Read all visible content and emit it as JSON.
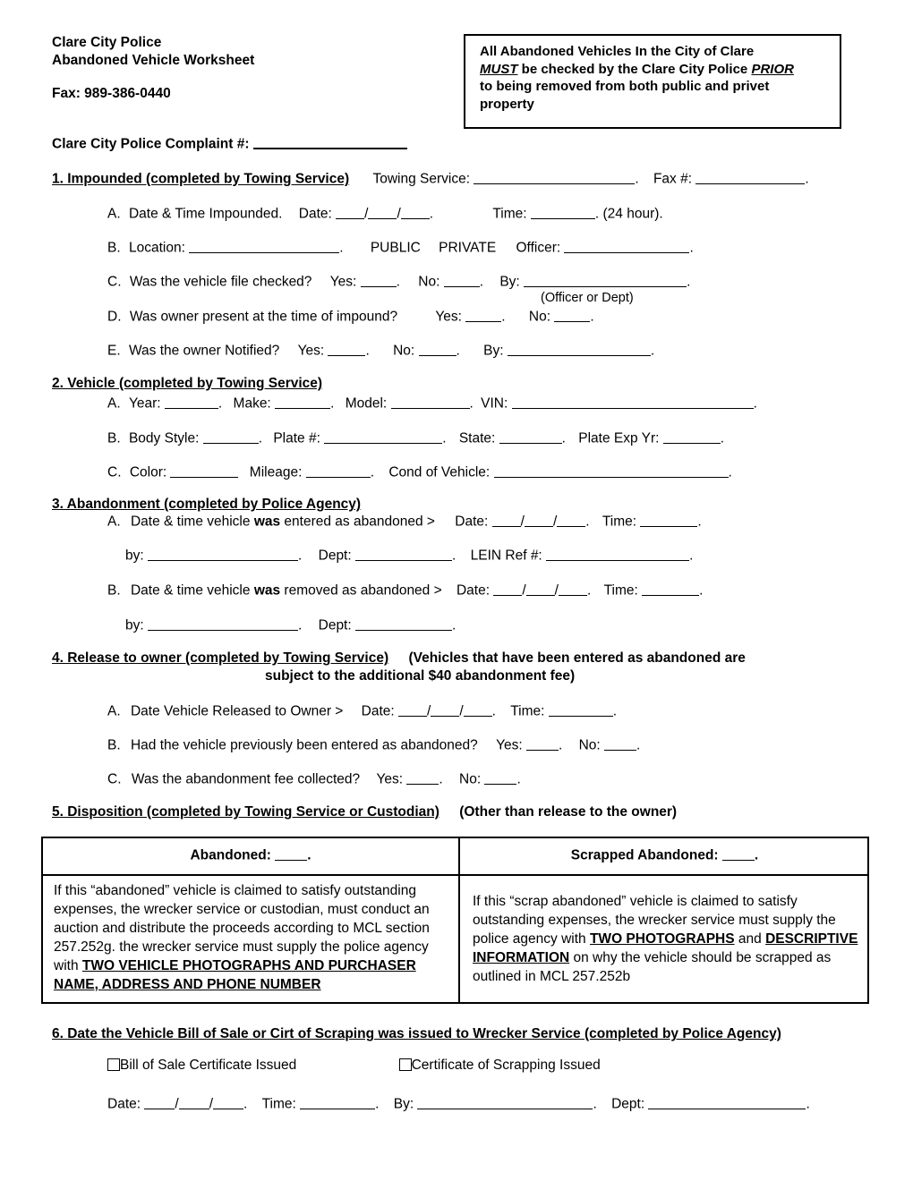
{
  "header": {
    "org_line1": "Clare City Police",
    "org_line2": "Abandoned Vehicle Worksheet",
    "fax": "Fax: 989-386-0440",
    "complaint_label": "Clare City Police Complaint #:"
  },
  "notice": {
    "line1": "All Abandoned Vehicles In the City of Clare",
    "must": "MUST",
    "line2_mid": " be checked by the Clare City Police ",
    "prior": "PRIOR",
    "line3": "to being removed from both public and privet",
    "line4": "property"
  },
  "section1": {
    "heading": "1. Impounded (completed by Towing Service)",
    "towing_service_label": "Towing Service:",
    "fax_label": "Fax #:",
    "a": {
      "letter": "A.",
      "text": "Date & Time Impounded.",
      "date_label": "Date:",
      "time_label": "Time:",
      "time_note": "(24 hour)."
    },
    "b": {
      "letter": "B.",
      "location_label": "Location:",
      "public": "PUBLIC",
      "private": "PRIVATE",
      "officer_label": "Officer:"
    },
    "c": {
      "letter": "C.",
      "text": "Was the vehicle file checked?",
      "yes_label": "Yes:",
      "no_label": "No:",
      "by_label": "By:",
      "sub_note": "(Officer or Dept)"
    },
    "d": {
      "letter": "D.",
      "text": "Was owner present at the time of impound?",
      "yes_label": "Yes:",
      "no_label": "No:"
    },
    "e": {
      "letter": "E.",
      "text": "Was the owner Notified?",
      "yes_label": "Yes:",
      "no_label": "No:",
      "by_label": "By:"
    }
  },
  "section2": {
    "heading": "2. Vehicle (completed by Towing Service)",
    "a": {
      "letter": "A.",
      "year_label": "Year:",
      "make_label": "Make:",
      "model_label": "Model:",
      "vin_label": "VIN:"
    },
    "b": {
      "letter": "B.",
      "body_style_label": "Body Style:",
      "plate_label": "Plate #:",
      "state_label": "State:",
      "plate_exp_label": "Plate Exp Yr:"
    },
    "c": {
      "letter": "C.",
      "color_label": "Color:",
      "mileage_label": "Mileage:",
      "cond_label": "Cond of Vehicle:"
    }
  },
  "section3": {
    "heading": "3. Abandonment (completed by Police Agency)",
    "a": {
      "letter": "A.",
      "pre": "Date & time vehicle ",
      "bold": "was",
      "post": " entered as abandoned >",
      "date_label": "Date:",
      "time_label": "Time:",
      "by_label": "by:",
      "dept_label": "Dept:",
      "lein_label": "LEIN Ref #:"
    },
    "b": {
      "letter": "B.",
      "pre": "Date & time vehicle ",
      "bold": "was",
      "post": " removed as abandoned >",
      "date_label": "Date:",
      "time_label": "Time:",
      "by_label": "by:",
      "dept_label": "Dept:"
    }
  },
  "section4": {
    "heading": "4. Release to owner (completed by Towing Service)",
    "note_line1": "(Vehicles that have been entered as abandoned are",
    "note_line2": "subject to the additional $40 abandonment fee)",
    "a": {
      "letter": "A.",
      "text": "Date Vehicle Released to Owner >",
      "date_label": "Date:",
      "time_label": "Time:"
    },
    "b": {
      "letter": "B.",
      "text": "Had the vehicle previously been entered as abandoned?",
      "yes_label": "Yes:",
      "no_label": "No:"
    },
    "c": {
      "letter": "C.",
      "text": "Was the abandonment fee collected?",
      "yes_label": "Yes:",
      "no_label": "No:"
    }
  },
  "section5": {
    "heading": "5. Disposition (completed by Towing Service or Custodian)",
    "note": "(Other than release to the owner)",
    "table": {
      "head_left": "Abandoned:",
      "head_left_suffix": ".",
      "head_right": "Scrapped Abandoned:",
      "head_right_suffix": ".",
      "body_left_pre": "If this “abandoned” vehicle is claimed to satisfy outstanding expenses, the wrecker service or custodian, must conduct an auction and distribute the proceeds according to MCL section 257.252g. the wrecker service must supply the police agency with ",
      "body_left_strong": "TWO VEHICLE PHOTOGRAPHS AND PURCHASER NAME, ADDRESS AND PHONE NUMBER",
      "body_right_pre": "If this “scrap abandoned” vehicle is claimed to satisfy outstanding expenses, the wrecker service must supply the police agency with ",
      "body_right_strong1": "TWO PHOTOGRAPHS",
      "body_right_mid": " and ",
      "body_right_strong2": "DESCRIPTIVE INFORMATION",
      "body_right_post": " on why the vehicle should be scrapped as outlined in MCL 257.252b"
    }
  },
  "section6": {
    "heading": "6. Date the Vehicle Bill of Sale or Cirt of Scraping was issued to Wrecker Service (completed by Police Agency)",
    "checkbox1_label": "Bill of Sale Certificate Issued",
    "checkbox2_label": "Certificate of Scrapping Issued",
    "date_label": "Date:",
    "time_label": "Time:",
    "by_label": "By:",
    "dept_label": "Dept:"
  }
}
